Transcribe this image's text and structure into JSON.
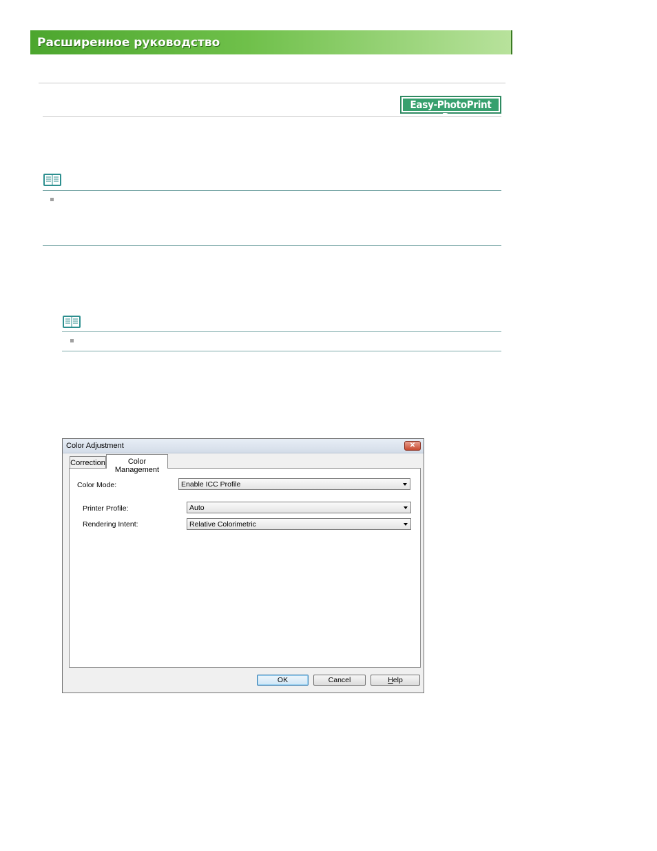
{
  "header": {
    "banner_title": "Расширенное руководство"
  },
  "product_logo": {
    "text": "Easy-PhotoPrint Pro",
    "color": "#37a06e"
  },
  "icons": {
    "note": "note-book-icon",
    "bullet": "square-bullet-icon",
    "close": "close-icon",
    "dropdown": "chevron-down-icon"
  },
  "dialog": {
    "title": "Color Adjustment",
    "close_glyph": "✕",
    "tabs": [
      {
        "label": "Correction"
      },
      {
        "label": "Color Management"
      }
    ],
    "active_tab": "Color Management",
    "fields": {
      "color_mode": {
        "label": "Color Mode:",
        "value": "Enable ICC Profile"
      },
      "printer_profile": {
        "label": "Printer Profile:",
        "value": "Auto"
      },
      "rendering_intent": {
        "label": "Rendering Intent:",
        "value": "Relative Colorimetric"
      }
    },
    "buttons": {
      "ok": "OK",
      "cancel": "Cancel",
      "help_first": "H",
      "help_rest": "elp"
    }
  }
}
